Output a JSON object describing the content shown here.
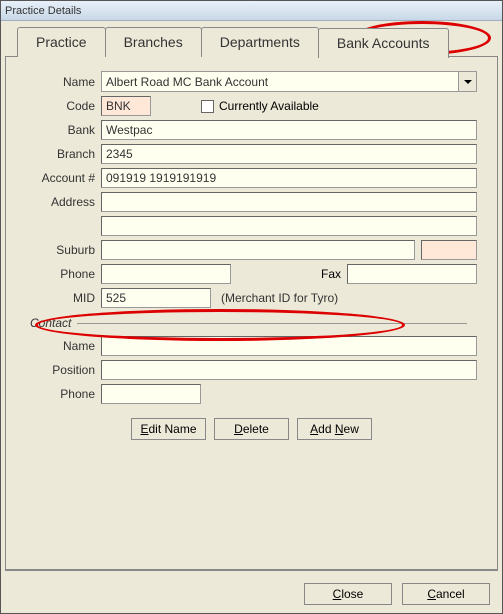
{
  "window": {
    "title": "Practice Details"
  },
  "tabs": {
    "practice": "Practice",
    "branches": "Branches",
    "departments": "Departments",
    "bankaccounts": "Bank Accounts"
  },
  "labels": {
    "name": "Name",
    "code": "Code",
    "currently_available": "Currently Available",
    "bank": "Bank",
    "branch": "Branch",
    "account_no": "Account #",
    "address": "Address",
    "suburb": "Suburb",
    "phone": "Phone",
    "fax": "Fax",
    "mid": "MID",
    "mid_note": "(Merchant ID for Tyro)",
    "contact": "Contact",
    "contact_name": "Name",
    "position": "Position",
    "contact_phone": "Phone"
  },
  "values": {
    "name": "Albert Road MC Bank Account",
    "code": "BNK",
    "currently_available": false,
    "bank": "Westpac",
    "branch": "2345",
    "account_no": "091919 1919191919",
    "address1": "",
    "address2": "",
    "suburb": "",
    "suburb2": "",
    "phone": "",
    "fax": "",
    "mid": "525",
    "contact_name": "",
    "position": "",
    "contact_phone": ""
  },
  "buttons": {
    "edit_name_pre": "E",
    "edit_name_rest": "dit Name",
    "delete_pre": "D",
    "delete_rest": "elete",
    "addnew_pre": "Add ",
    "addnew_u": "N",
    "addnew_rest": "ew",
    "close": "Close",
    "cancel": "Cancel"
  }
}
